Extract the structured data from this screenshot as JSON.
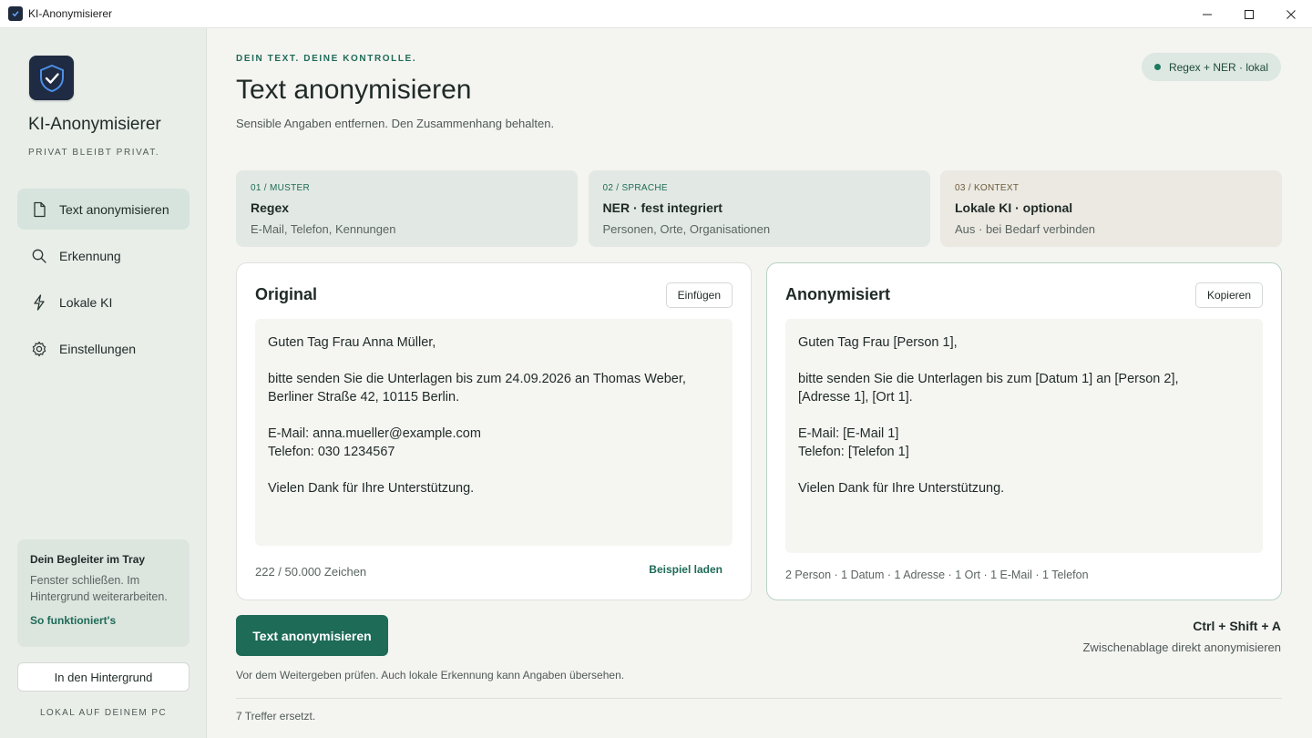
{
  "window": {
    "title": "KI-Anonymisierer",
    "controls": [
      "minimize-icon",
      "maximize-icon",
      "close-icon"
    ]
  },
  "sidebar": {
    "brand": "KI-Anonymisierer",
    "tagline": "PRIVAT BLEIBT PRIVAT.",
    "items": [
      {
        "label": "Text anonymisieren",
        "icon": "document-icon",
        "active": true
      },
      {
        "label": "Erkennung",
        "icon": "search-icon",
        "active": false
      },
      {
        "label": "Lokale KI",
        "icon": "lightning-icon",
        "active": false
      },
      {
        "label": "Einstellungen",
        "icon": "gear-icon",
        "active": false
      }
    ],
    "tray": {
      "title": "Dein Begleiter im Tray",
      "text": "Fenster schließen. Im Hintergrund weiterarbeiten.",
      "link": "So funktioniert's"
    },
    "background_button": "In den Hintergrund",
    "footer": "LOKAL AUF DEINEM PC"
  },
  "header": {
    "eyebrow": "DEIN TEXT. DEINE KONTROLLE.",
    "title": "Text anonymisieren",
    "subtitle": "Sensible Angaben entfernen. Den Zusammenhang behalten.",
    "status": "Regex + NER · lokal"
  },
  "stages": [
    {
      "step": "01 / MUSTER",
      "title": "Regex",
      "desc": "E-Mail, Telefon, Kennungen"
    },
    {
      "step": "02 / SPRACHE",
      "title": "NER · fest integriert",
      "desc": "Personen, Orte, Organisationen"
    },
    {
      "step": "03 / KONTEXT",
      "title": "Lokale KI · optional",
      "desc": "Aus · bei Bedarf verbinden"
    }
  ],
  "original": {
    "title": "Original",
    "button": "Einfügen",
    "text": "Guten Tag Frau Anna Müller,\n\nbitte senden Sie die Unterlagen bis zum 24.09.2026 an Thomas Weber,\nBerliner Straße 42, 10115 Berlin.\n\nE-Mail: anna.mueller@example.com\nTelefon: 030 1234567\n\nVielen Dank für Ihre Unterstützung.",
    "count": "222 / 50.000 Zeichen",
    "example_link": "Beispiel laden"
  },
  "anonymized": {
    "title": "Anonymisiert",
    "button": "Kopieren",
    "text": "Guten Tag Frau [Person 1],\n\nbitte senden Sie die Unterlagen bis zum [Datum 1] an [Person 2],\n[Adresse 1], [Ort 1].\n\nE-Mail: [E-Mail 1]\nTelefon: [Telefon 1]\n\nVielen Dank für Ihre Unterstützung.",
    "summary": "2 Person · 1 Datum · 1 Adresse · 1 Ort · 1 E-Mail · 1 Telefon"
  },
  "actions": {
    "primary": "Text anonymisieren",
    "shortcut": "Ctrl + Shift + A",
    "shortcut_desc": "Zwischenablage direkt anonymisieren",
    "warning": "Vor dem Weitergeben prüfen. Auch lokale Erkennung kann Angaben übersehen.",
    "status": "7 Treffer ersetzt."
  },
  "colors": {
    "accent": "#1e6b57",
    "sidebar_bg": "#e9eee9",
    "logo_bg": "#1f2b42"
  }
}
